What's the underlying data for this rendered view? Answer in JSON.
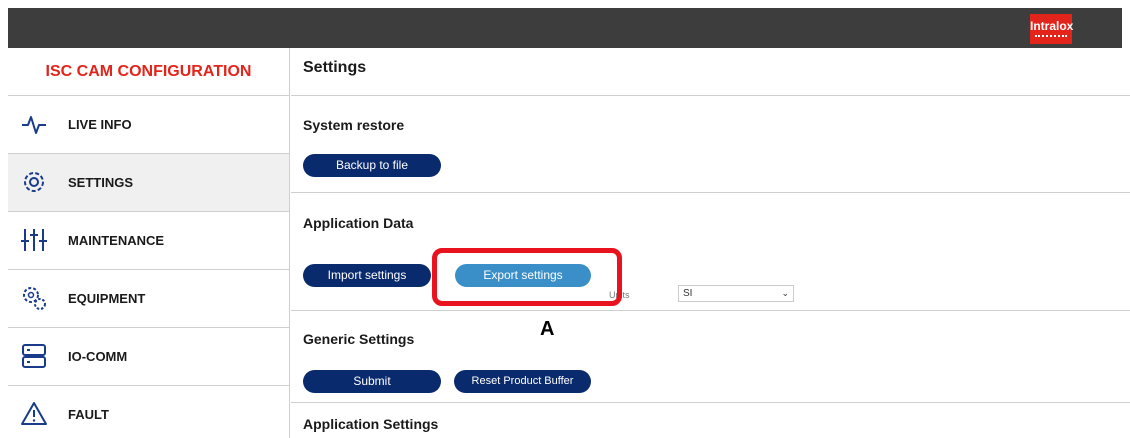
{
  "header": {
    "logo_text": "Intralox"
  },
  "sidebar": {
    "title": "ISC CAM CONFIGURATION",
    "items": [
      {
        "label": "LIVE INFO",
        "icon": "pulse-icon"
      },
      {
        "label": "SETTINGS",
        "icon": "gear-icon",
        "active": true
      },
      {
        "label": "MAINTENANCE",
        "icon": "sliders-icon"
      },
      {
        "label": "EQUIPMENT",
        "icon": "gears-icon"
      },
      {
        "label": "IO-COMM",
        "icon": "server-icon"
      },
      {
        "label": "FAULT",
        "icon": "warning-icon"
      }
    ]
  },
  "main": {
    "page_title": "Settings",
    "system_restore": {
      "title": "System restore",
      "backup_label": "Backup to file"
    },
    "application_data": {
      "title": "Application Data",
      "import_label": "Import settings",
      "export_label": "Export settings",
      "units_label": "Units",
      "units_value": "SI"
    },
    "generic_settings": {
      "title": "Generic Settings",
      "submit_label": "Submit",
      "reset_label": "Reset Product Buffer"
    },
    "application_settings": {
      "title": "Application Settings"
    }
  },
  "annotation": {
    "label": "A",
    "color": "#e8131f"
  },
  "colors": {
    "accent_red": "#e3241b",
    "button_dark": "#0a2a6e",
    "button_light": "#3b8fc9",
    "topbar": "#3d3d3d"
  }
}
